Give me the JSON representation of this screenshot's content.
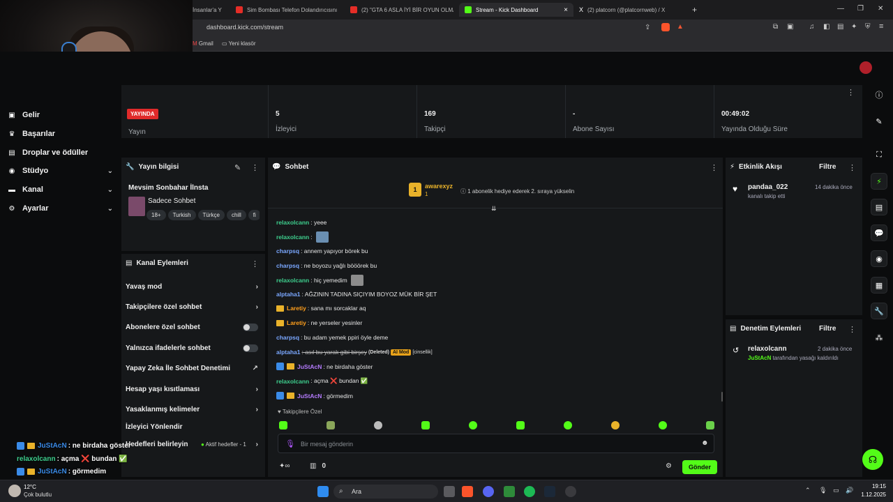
{
  "browser": {
    "tabs": [
      {
        "label": "İnsanlar'a Y",
        "active": false
      },
      {
        "label": "Sim Bombası Telefon Dolandırıcısını",
        "active": false
      },
      {
        "label": "(2) \"GTA 6 ASLA İYİ BİR OYUN OLMA",
        "active": false
      },
      {
        "label": "Stream - Kick Dashboard",
        "active": true
      },
      {
        "label": "(2) platcorn (@platcornweb) / X",
        "active": false
      }
    ],
    "url": "dashboard.kick.com/stream",
    "bookmarks": [
      "Gmail",
      "Yeni klasör"
    ],
    "new_tab": "+",
    "close_tab": "×"
  },
  "sidebar": {
    "items": [
      {
        "label": "Gelir",
        "icon": "revenue-icon",
        "expandable": false
      },
      {
        "label": "Başarılar",
        "icon": "trophy-icon",
        "expandable": false
      },
      {
        "label": "Droplar ve ödüller",
        "icon": "drops-icon",
        "expandable": false
      },
      {
        "label": "Stüdyo",
        "icon": "studio-icon",
        "expandable": true
      },
      {
        "label": "Kanal",
        "icon": "channel-icon",
        "expandable": true
      },
      {
        "label": "Ayarlar",
        "icon": "gear-icon",
        "expandable": true
      }
    ]
  },
  "stats": {
    "live_badge": "YAYINDA",
    "stream_label": "Yayın",
    "viewers_value": "5",
    "viewers_label": "İzleyici",
    "followers_value": "169",
    "followers_label": "Takipçi",
    "subs_value": "-",
    "subs_label": "Abone Sayısı",
    "uptime_value": "00:49:02",
    "uptime_label": "Yayında Olduğu Süre"
  },
  "stream_info": {
    "title": "Yayın bilgisi",
    "stream_title": "Mevsim Sonbahar İlnsta",
    "category": "Sadece Sohbet",
    "tags": [
      "18+",
      "Turkish",
      "Türkçe",
      "chill",
      "fi"
    ]
  },
  "channel_actions": {
    "title": "Kanal Eylemleri",
    "items": [
      {
        "label": "Yavaş mod",
        "control": "arrow"
      },
      {
        "label": "Takipçilere özel sohbet",
        "control": "arrow"
      },
      {
        "label": "Abonelere özel sohbet",
        "control": "toggle"
      },
      {
        "label": "Yalnızca ifadelerle sohbet",
        "control": "toggle"
      },
      {
        "label": "Yapay Zeka İle Sohbet Denetimi",
        "control": "external"
      },
      {
        "label": "Hesap yaşı kısıtlaması",
        "control": "arrow"
      },
      {
        "label": "Yasaklanmış kelimeler",
        "control": "arrow"
      },
      {
        "label": "İzleyici Yönlendir",
        "control": "none"
      },
      {
        "label": "Hedefleri belirleyin",
        "control": "arrow",
        "extra": "Aktif hedefler - 1"
      }
    ]
  },
  "chat": {
    "title": "Sohbet",
    "pinned": {
      "rank": "1",
      "user": "awarexyz",
      "sub": "1",
      "text": "1 abonelik hediye ederek 2. sıraya yükselin"
    },
    "messages": [
      {
        "user": "relaxolcann",
        "color": "teal",
        "text": ": yeee",
        "badges": []
      },
      {
        "user": "relaxolcann",
        "color": "teal",
        "text": ":",
        "badges": [],
        "emote": true
      },
      {
        "user": "charpsq",
        "color": "blue",
        "text": ": annem yapıyor börek bu",
        "badges": []
      },
      {
        "user": "charpsq",
        "color": "blue",
        "text": ": ne boyozu yağlı bööörek bu",
        "badges": []
      },
      {
        "user": "relaxolcann",
        "color": "teal",
        "text": ": hiç yemedim",
        "badges": [],
        "emote": true
      },
      {
        "user": "alptaha1",
        "color": "blue",
        "text": ": AĞZININ TADINA SIÇIYIM BOYOZ MÜK BİR ŞET",
        "badges": []
      },
      {
        "user": "Laretiy",
        "color": "orange",
        "text": ": sana mı sorcaklar aq",
        "badges": [
          "crown"
        ]
      },
      {
        "user": "Laretiy",
        "color": "orange",
        "text": ": ne yerseler yesinler",
        "badges": [
          "crown"
        ]
      },
      {
        "user": "charpsq",
        "color": "blue",
        "text": ": bu adam yemek ppiri öyle deme",
        "badges": []
      },
      {
        "user": "alptaha1",
        "color": "blue",
        "text": ": asıl bu yarak gibi birşey",
        "badges": [],
        "deleted": "(Deleted)",
        "ai": "AI Mod",
        "reason": "[cinsellik]"
      },
      {
        "user": "JuStAcN",
        "color": "purple",
        "text": ": ne birdaha göster",
        "badges": [
          "bolt",
          "crown"
        ]
      },
      {
        "user": "relaxolcann",
        "color": "teal",
        "text": ": açma ❌ bundan ✅",
        "badges": []
      },
      {
        "user": "JuStAcN",
        "color": "purple",
        "text": ": görmedim",
        "badges": [
          "bolt",
          "crown"
        ]
      }
    ],
    "follower_emotes_label": "Takipçilere Özel",
    "input_placeholder": "Bir mesaj gönderin",
    "points": "0",
    "send_label": "Gönder"
  },
  "activity": {
    "title": "Etkinlik Akışı",
    "filter": "Filtre",
    "events": [
      {
        "user": "pandaa_022",
        "text": "kanalı takip etti",
        "time": "14 dakika önce"
      }
    ]
  },
  "moderation": {
    "title": "Denetim Eylemleri",
    "filter": "Filtre",
    "events": [
      {
        "user": "relaxolcann",
        "actor": "JuStAcN",
        "text": "tarafından yasağı kaldırıldı",
        "time": "2 dakika önce"
      }
    ]
  },
  "overlay_chat": [
    {
      "user": "JuStAcN",
      "text": ": ne birdaha göster"
    },
    {
      "user": "relaxolcann",
      "text": ": açma ❌ bundan ✅"
    },
    {
      "user": "JuStAcN",
      "text": ": görmedim"
    }
  ],
  "taskbar": {
    "weather_temp": "12°C",
    "weather_desc": "Çok bulutlu",
    "search": "Ara",
    "time": "19:15",
    "date": "1.12.2025"
  },
  "colors": {
    "accent": "#53fc18",
    "live": "#e02a2a",
    "panel": "#16181a"
  }
}
